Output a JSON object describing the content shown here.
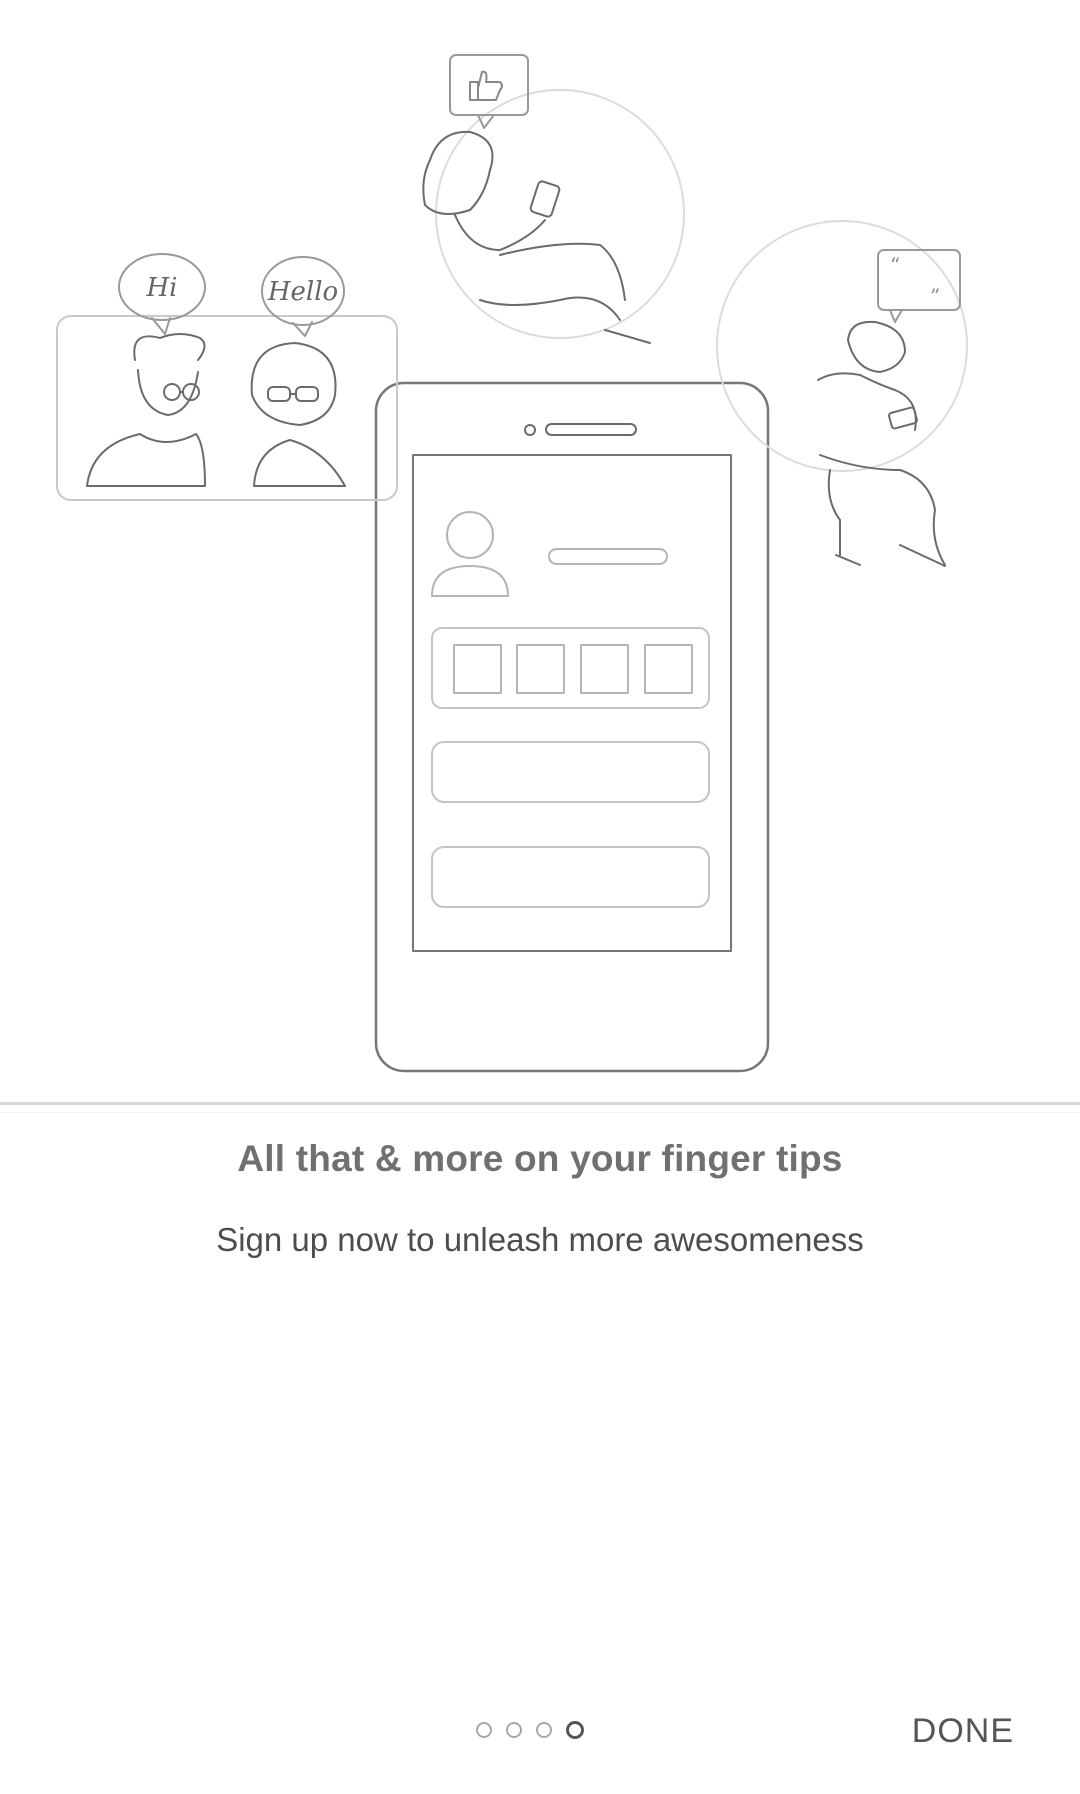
{
  "illustration": {
    "bubble_hi": "Hi",
    "bubble_hello": "Hello"
  },
  "onboarding": {
    "title": "All that & more on your finger tips",
    "subtitle": "Sign up now to unleash more awesomeness"
  },
  "pager": {
    "count": 4,
    "active_index": 3
  },
  "footer": {
    "done_label": "DONE"
  }
}
